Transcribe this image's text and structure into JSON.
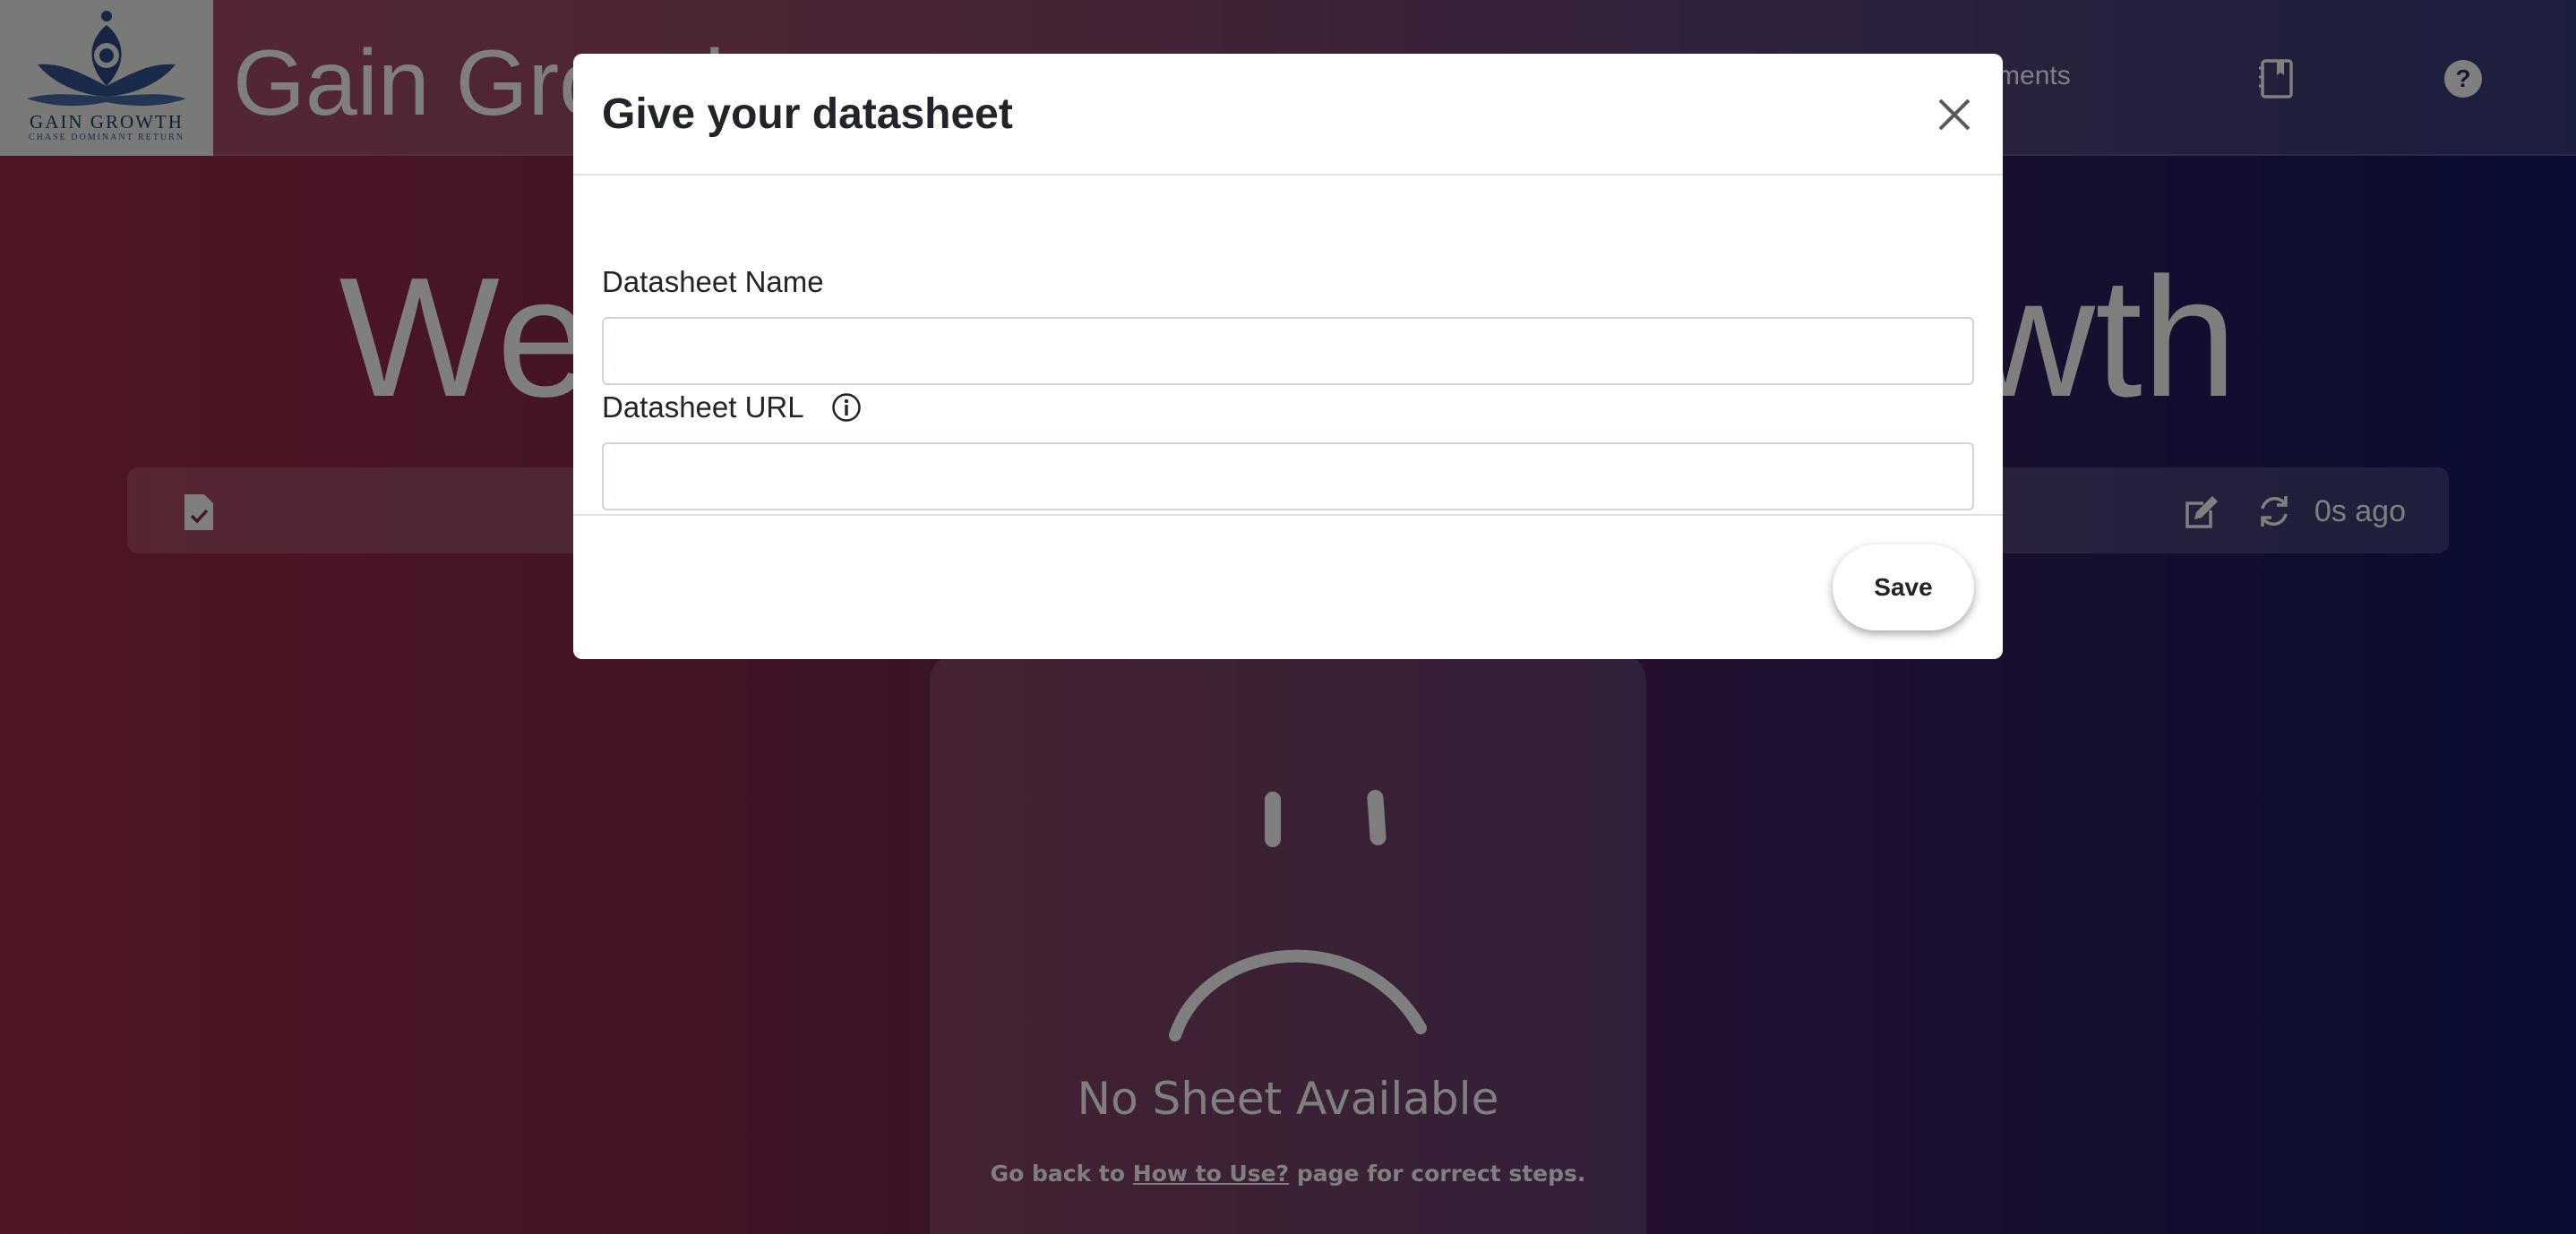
{
  "navbar": {
    "logo": {
      "title": "GAIN GROWTH",
      "tagline": "CHASE DOMINANT RETURN"
    },
    "brand": "Gain Growth",
    "investments_label": "Investments",
    "icons": [
      "notebook-icon",
      "help-icon"
    ]
  },
  "hero": {
    "heading": "Welcome to Gain Growth"
  },
  "toolbar": {
    "time_ago": "0s ago",
    "icons": [
      "file-check-icon",
      "edit-icon",
      "refresh-icon"
    ]
  },
  "empty_state": {
    "title": "No Sheet Available",
    "hint_prefix": "Go back to ",
    "hint_link": "How to Use?",
    "hint_suffix": " page for correct steps."
  },
  "modal": {
    "title": "Give your datasheet",
    "name_label": "Datasheet Name",
    "name_value": "",
    "url_label": "Datasheet URL",
    "url_value": "",
    "save_label": "Save"
  },
  "colors": {
    "gradient_left": "#a02c48",
    "gradient_right": "#14186a",
    "overlay": "rgba(0,0,0,0.5)",
    "modal_bg": "#ffffff",
    "text_dark": "#212529",
    "border": "#dee2e6"
  }
}
